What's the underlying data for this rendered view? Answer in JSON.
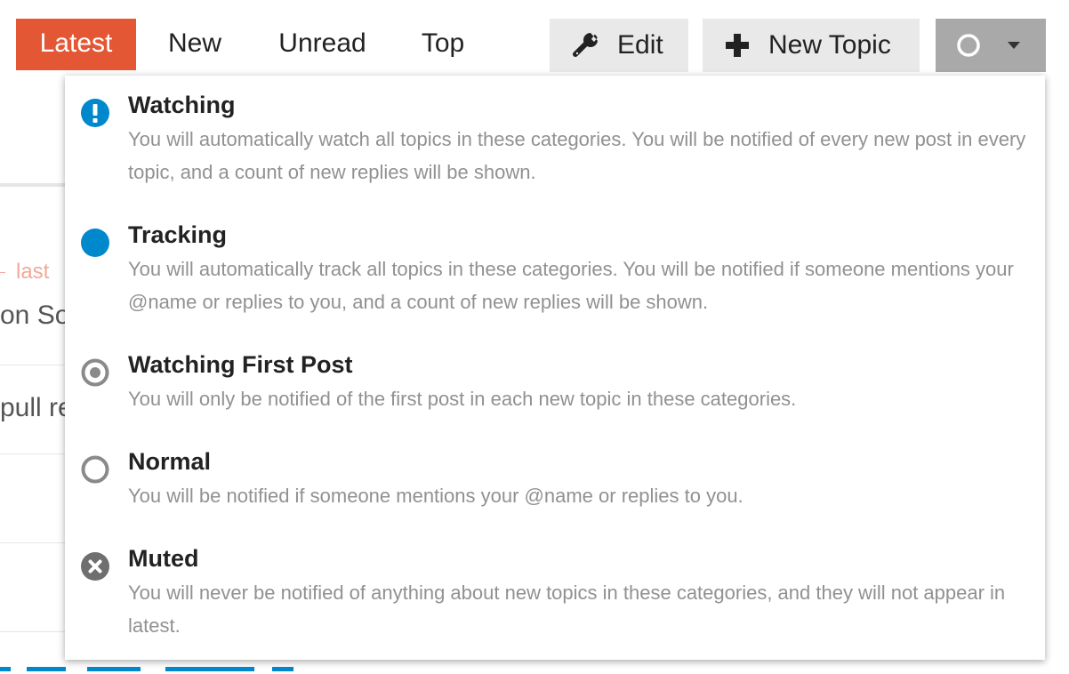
{
  "nav": {
    "tabs": [
      {
        "label": "Latest",
        "active": true
      },
      {
        "label": "New"
      },
      {
        "label": "Unread"
      },
      {
        "label": "Top"
      }
    ],
    "edit_label": "Edit",
    "new_topic_label": "New Topic",
    "accent_color": "#e45735"
  },
  "background": {
    "fragment_1": "last",
    "fragment_2": "on So",
    "fragment_3": "pull re"
  },
  "dropdown": {
    "options": [
      {
        "title": "Watching",
        "icon": "exclamation-circle-icon",
        "description": "You will automatically watch all topics in these categories. You will be notified of every new post in every topic, and a count of new replies will be shown."
      },
      {
        "title": "Tracking",
        "icon": "filled-circle-icon",
        "description": "You will automatically track all topics in these categories. You will be notified if someone mentions your @name or replies to you, and a count of new replies will be shown."
      },
      {
        "title": "Watching First Post",
        "icon": "dot-circle-icon",
        "description": "You will only be notified of the first post in each new topic in these categories."
      },
      {
        "title": "Normal",
        "icon": "empty-circle-icon",
        "description": "You will be notified if someone mentions your @name or replies to you."
      },
      {
        "title": "Muted",
        "icon": "times-circle-icon",
        "description": "You will never be notified of anything about new topics in these categories, and they will not appear in latest."
      }
    ]
  }
}
